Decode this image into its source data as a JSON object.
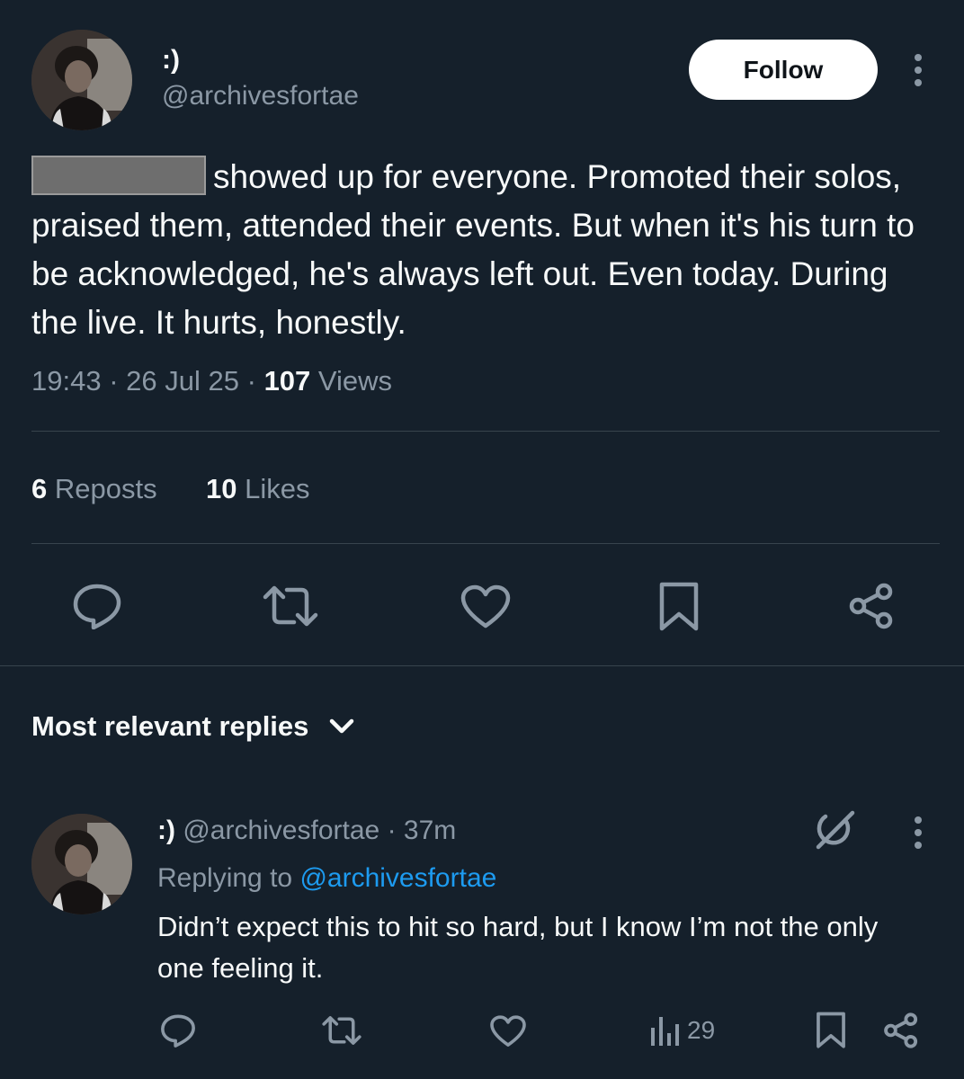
{
  "post": {
    "display_name": ":)",
    "handle": "@archivesfortae",
    "follow_label": "Follow",
    "text": "showed up for everyone. Promoted their solos, praised them, attended their events. But when it's his turn to be acknowledged, he's always left out. Even today. During the live. It hurts, honestly.",
    "time": "19:43",
    "sep1": "·",
    "date": "26 Jul 25",
    "sep2": "·",
    "views_count": "107",
    "views_label": "Views"
  },
  "stats": {
    "reposts_count": "6",
    "reposts_label": "Reposts",
    "likes_count": "10",
    "likes_label": "Likes"
  },
  "replies_header": {
    "label": "Most relevant replies"
  },
  "reply": {
    "display_name": ":)",
    "handle": "@archivesfortae",
    "age": "· 37m",
    "replying_prefix": "Replying to",
    "replying_handle": "@archivesfortae",
    "text": "Didn’t expect this to hit so hard, but I know I’m not the only one feeling it.",
    "views_count": "29"
  },
  "icons": {
    "reply": "reply-icon",
    "repost": "repost-icon",
    "like": "like-icon",
    "bookmark": "bookmark-icon",
    "share": "share-icon",
    "more": "more-icon",
    "chevron": "chevron-down-icon",
    "views": "views-icon",
    "grok": "grok-icon"
  },
  "colors": {
    "background": "#15202b",
    "text": "#f7f9f9",
    "muted": "#8b98a5",
    "link": "#1d9bf0",
    "divider": "#38444d",
    "follow_bg": "#ffffff",
    "follow_text": "#0f1419"
  }
}
